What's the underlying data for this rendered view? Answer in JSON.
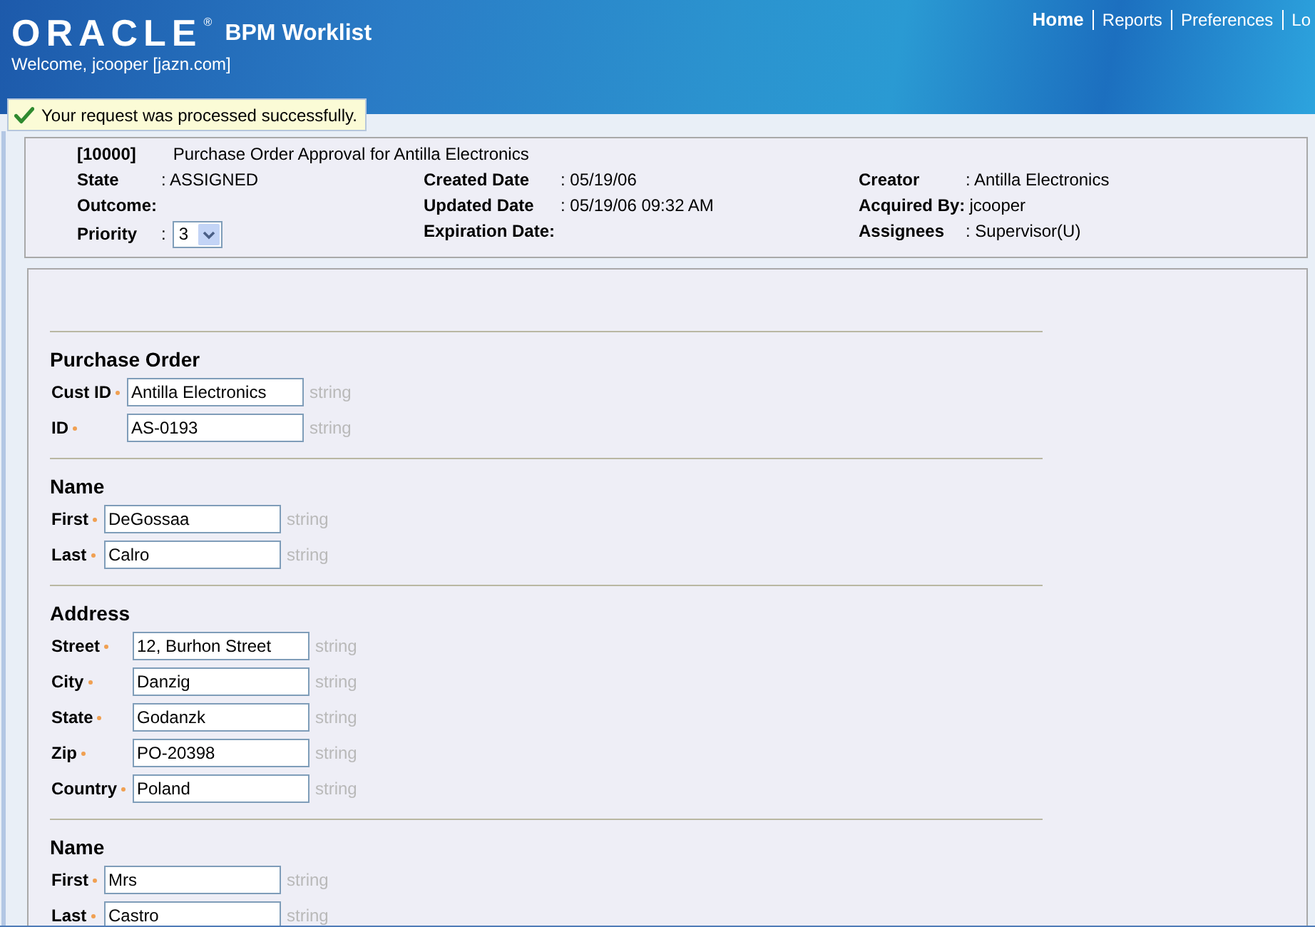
{
  "header": {
    "logo": "ORACLE",
    "logo_mark": "®",
    "title": "BPM Worklist",
    "welcome": "Welcome, jcooper [jazn.com]",
    "nav": [
      {
        "label": "Home",
        "selected": true
      },
      {
        "label": "Reports",
        "selected": false
      },
      {
        "label": "Preferences",
        "selected": false
      },
      {
        "label": "Lo",
        "selected": false
      }
    ]
  },
  "message": {
    "text": "Your request was processed successfully."
  },
  "task": {
    "number": "[10000]",
    "title": "Purchase Order Approval for Antilla Electronics",
    "columns": [
      [
        {
          "kind": "text",
          "label": "State",
          "value": ": ASSIGNED"
        },
        {
          "kind": "text",
          "label": "Outcome:"
        },
        {
          "kind": "select",
          "label": "Priority",
          "value": ":",
          "option": "3"
        }
      ],
      [
        {
          "kind": "text",
          "label": "Created Date",
          "value": ": 05/19/06"
        },
        {
          "kind": "text",
          "label": "Updated Date",
          "value": ": 05/19/06 09:32 AM"
        },
        {
          "kind": "text",
          "label": "Expiration Date:"
        }
      ],
      [
        {
          "kind": "text",
          "label": "Creator",
          "value": ": Antilla Electronics"
        },
        {
          "kind": "text",
          "label": "Acquired By:",
          "value": "jcooper"
        },
        {
          "kind": "text",
          "label": "Assignees",
          "value": ": Supervisor(U)"
        }
      ]
    ]
  },
  "form": {
    "sections": [
      {
        "title": "Purchase Order",
        "fields": [
          {
            "label": "Cust ID",
            "required": true,
            "value": "Antilla Electronics",
            "hint": "string"
          },
          {
            "label": "ID",
            "required": true,
            "value": "AS-0193",
            "hint": "string"
          }
        ]
      },
      {
        "title": "Name",
        "fields": [
          {
            "label": "First",
            "required": true,
            "value": "DeGossaa",
            "hint": "string"
          },
          {
            "label": "Last",
            "required": true,
            "value": "Calro",
            "hint": "string"
          }
        ]
      },
      {
        "title": "Address",
        "fields": [
          {
            "label": "Street",
            "required": true,
            "value": "12, Burhon Street",
            "hint": "string"
          },
          {
            "label": "City",
            "required": true,
            "value": "Danzig",
            "hint": "string"
          },
          {
            "label": "State",
            "required": true,
            "value": "Godanzk",
            "hint": "string"
          },
          {
            "label": "Zip",
            "required": true,
            "value": "PO-20398",
            "hint": "string"
          },
          {
            "label": "Country",
            "required": true,
            "value": "Poland",
            "hint": "string"
          }
        ]
      },
      {
        "title": "Name",
        "fields": [
          {
            "label": "First",
            "required": true,
            "value": "Mrs",
            "hint": "string"
          },
          {
            "label": "Last",
            "required": true,
            "value": "Castro",
            "hint": "string"
          }
        ]
      }
    ]
  }
}
